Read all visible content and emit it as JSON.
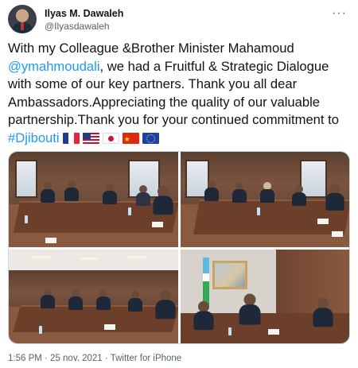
{
  "tweet": {
    "author_name": "Ilyas M. Dawaleh",
    "author_handle": "@Ilyasdawaleh",
    "more_label": "···",
    "text_part1": "With my Colleague &Brother Minister Mahamoud ",
    "mention": "@ymahmoudali",
    "text_part2": ", we had a Fruitful & Strategic Dialogue with some of our key partners. Thank you all dear Ambassadors.Appreciating the quality of our valuable partnership.Thank you for your continued commitment to ",
    "hashtag": "#Djibouti",
    "flags": [
      "france-flag-icon",
      "usa-flag-icon",
      "japan-flag-icon",
      "china-flag-icon",
      "eu-flag-icon"
    ],
    "timestamp": "1:56 PM · 25 nov. 2021 · Twitter for iPhone"
  },
  "colors": {
    "link": "#1d9bf0",
    "secondary_text": "#536471",
    "primary_text": "#0f1419"
  }
}
